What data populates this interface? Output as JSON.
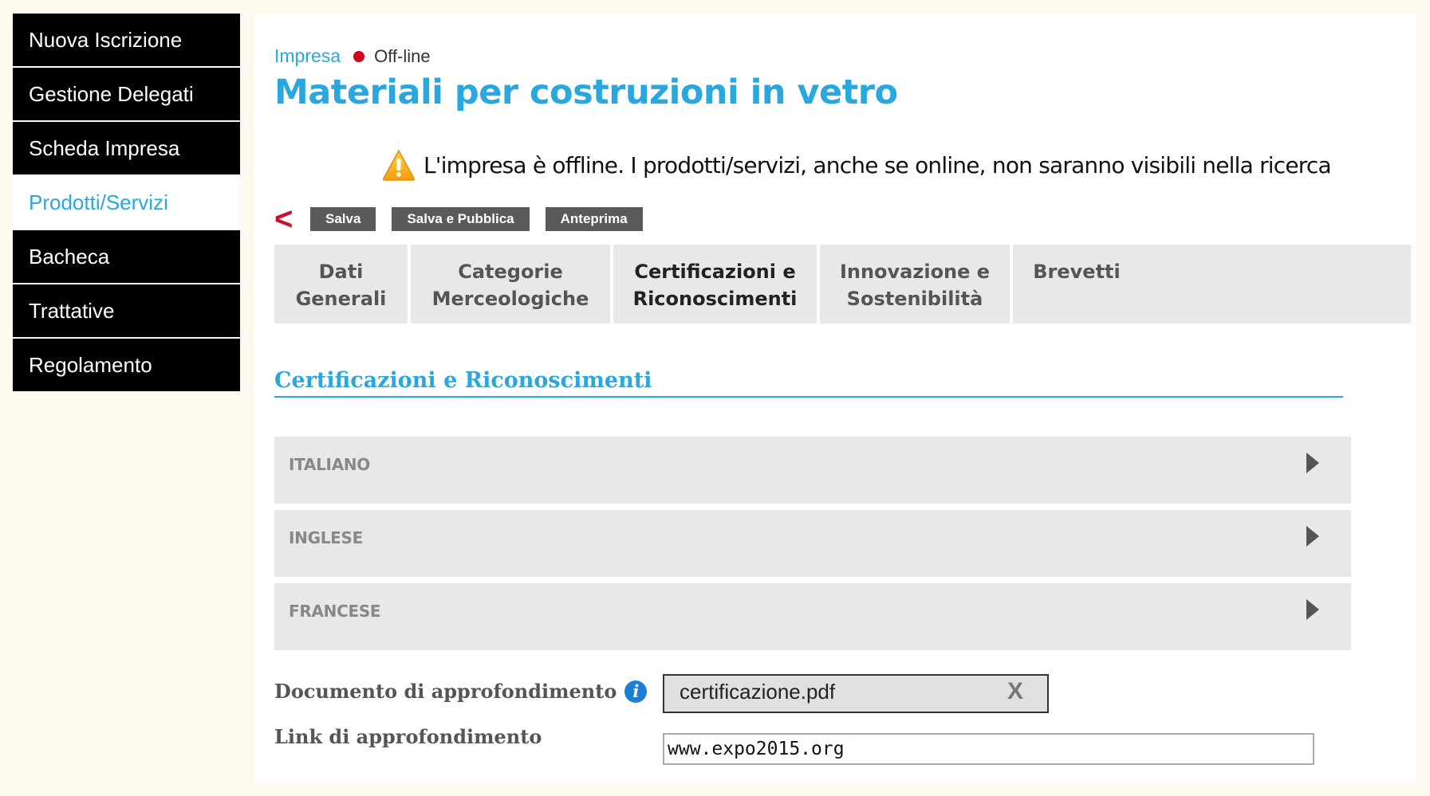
{
  "sidebar": {
    "items": [
      {
        "label": "Nuova Iscrizione"
      },
      {
        "label": "Gestione Delegati"
      },
      {
        "label": "Scheda Impresa"
      },
      {
        "label": "Prodotti/Servizi"
      },
      {
        "label": "Bacheca"
      },
      {
        "label": "Trattative"
      },
      {
        "label": "Regolamento"
      }
    ]
  },
  "header": {
    "crumb": "Impresa",
    "status": "Off-line",
    "status_color": "#d0021b",
    "title": "Materiali per costruzioni in vetro",
    "warning_icon": "warning-icon",
    "warning": "L'impresa è offline. I prodotti/servizi, anche se online, non saranno visibili nella ricerca"
  },
  "toolbar": {
    "back_icon": "chevron-left-icon",
    "save_label": "Salva",
    "save_publish_label": "Salva e Pubblica",
    "preview_label": "Anteprima"
  },
  "tabs": [
    {
      "line1": "Dati",
      "line2": "Generali"
    },
    {
      "line1": "Categorie",
      "line2": "Merceologiche"
    },
    {
      "line1": "Certificazioni e",
      "line2": "Riconoscimenti"
    },
    {
      "line1": "Innovazione e",
      "line2": "Sostenibilità"
    },
    {
      "line1": "Brevetti",
      "line2": ""
    }
  ],
  "section": {
    "title": "Certificazioni e Riconoscimenti",
    "languages": [
      {
        "label": "ITALIANO"
      },
      {
        "label": "INGLESE"
      },
      {
        "label": "FRANCESE"
      }
    ]
  },
  "fields": {
    "document_label": "Documento di approfondimento",
    "document_file": "certificazione.pdf",
    "remove_label": "X",
    "link_label": "Link di approfondimento",
    "link_value": "www.expo2015.org"
  },
  "colors": {
    "accent": "#29a8e0",
    "sidebar_bg": "#000000",
    "button_bg": "#5a5a5a",
    "back_arrow": "#c8102e"
  }
}
